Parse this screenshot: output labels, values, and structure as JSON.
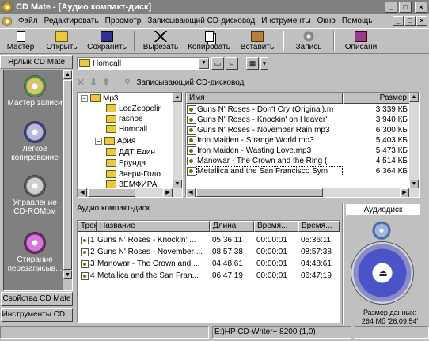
{
  "window": {
    "title": "CD Mate - [Аудио компакт-диск]",
    "min": "_",
    "max": "□",
    "close": "×"
  },
  "menu": [
    "Файл",
    "Редактировать",
    "Просмотр",
    "Записывающий CD-дисковод",
    "Инструменты",
    "Окно",
    "Помощь"
  ],
  "toolbar": {
    "buttons": [
      "Мастер",
      "Открыть",
      "Сохранить",
      "Вырезать",
      "Копировать",
      "Вставить",
      "Запись",
      "Описани"
    ]
  },
  "left_panel": {
    "tab": "Ярлык CD Mate",
    "items": [
      "Мастер записи",
      "Лёгкое копирование",
      "Управление CD-ROMом",
      "Стирание перезаписыв..."
    ],
    "bottom_buttons": [
      "Свойства CD Mate",
      "Инструменты CD..."
    ]
  },
  "path": {
    "current": "Homcall"
  },
  "cd_toolbar": {
    "label": "Записывающий CD-дисковод"
  },
  "tree": {
    "nodes": [
      {
        "label": "Mp3",
        "expander": "−",
        "level": 0
      },
      {
        "label": "LedZeppelir",
        "expander": "",
        "level": 1
      },
      {
        "label": "rasnoe",
        "expander": "",
        "level": 1
      },
      {
        "label": "Homcall",
        "expander": "",
        "level": 1
      },
      {
        "label": "Ария",
        "expander": "−",
        "level": 1
      },
      {
        "label": "ДДТ Един",
        "expander": "",
        "level": 1
      },
      {
        "label": "Ерунда",
        "expander": "",
        "level": 1
      },
      {
        "label": "Звери-Голо",
        "expander": "",
        "level": 1
      },
      {
        "label": "ЗЕМФИРА",
        "expander": "",
        "level": 1
      }
    ]
  },
  "file_list": {
    "columns": [
      "Имя",
      "Размер"
    ],
    "files": [
      {
        "name": "Guns N' Roses - Don't Cry (Original).m",
        "size": "3 339 КБ"
      },
      {
        "name": "Guns N' Roses - Knockin' on Heaver'",
        "size": "3 940 КБ"
      },
      {
        "name": "Guns N' Roses - November Rain.mp3",
        "size": "6 300 КБ"
      },
      {
        "name": "Iron Maiden - Strange World.mp3",
        "size": "5 403 КБ"
      },
      {
        "name": "Iron Maiden - Wasting Love.mp3",
        "size": "5 473 КБ"
      },
      {
        "name": "Manowar - The Crown and the Ring (",
        "size": "4 514 КБ"
      },
      {
        "name": "Metallica and the San Francisco Sym",
        "size": "6 364 КБ"
      }
    ]
  },
  "audio_cd": {
    "label": "Аудио компакт-диск",
    "columns": [
      "Трек",
      "Название",
      "Длина",
      "Время...",
      "Время..."
    ],
    "tracks": [
      {
        "n": "1",
        "name": "Guns N' Roses - Knockin' ...",
        "len": "05:36:11",
        "t1": "00:00:01",
        "t2": "05:36:11"
      },
      {
        "n": "2",
        "name": "Guns N' Roses - November ...",
        "len": "08:57:38",
        "t1": "00:00:01",
        "t2": "08:57:38"
      },
      {
        "n": "3",
        "name": "Manowar - The Crown and ...",
        "len": "04:48:61",
        "t1": "00:00:01",
        "t2": "04:48:61"
      },
      {
        "n": "4",
        "name": "Metallica and the San Fran...",
        "len": "06:47:19",
        "t1": "00:00:01",
        "t2": "06:47:19"
      }
    ]
  },
  "side": {
    "tab": "Аудиодиск",
    "size_label": "Размер данных:",
    "size_value": "264 Мб '26:09:54'"
  },
  "status": {
    "drive": "E:)HP CD-Writer+ 8200  (1,0)"
  }
}
